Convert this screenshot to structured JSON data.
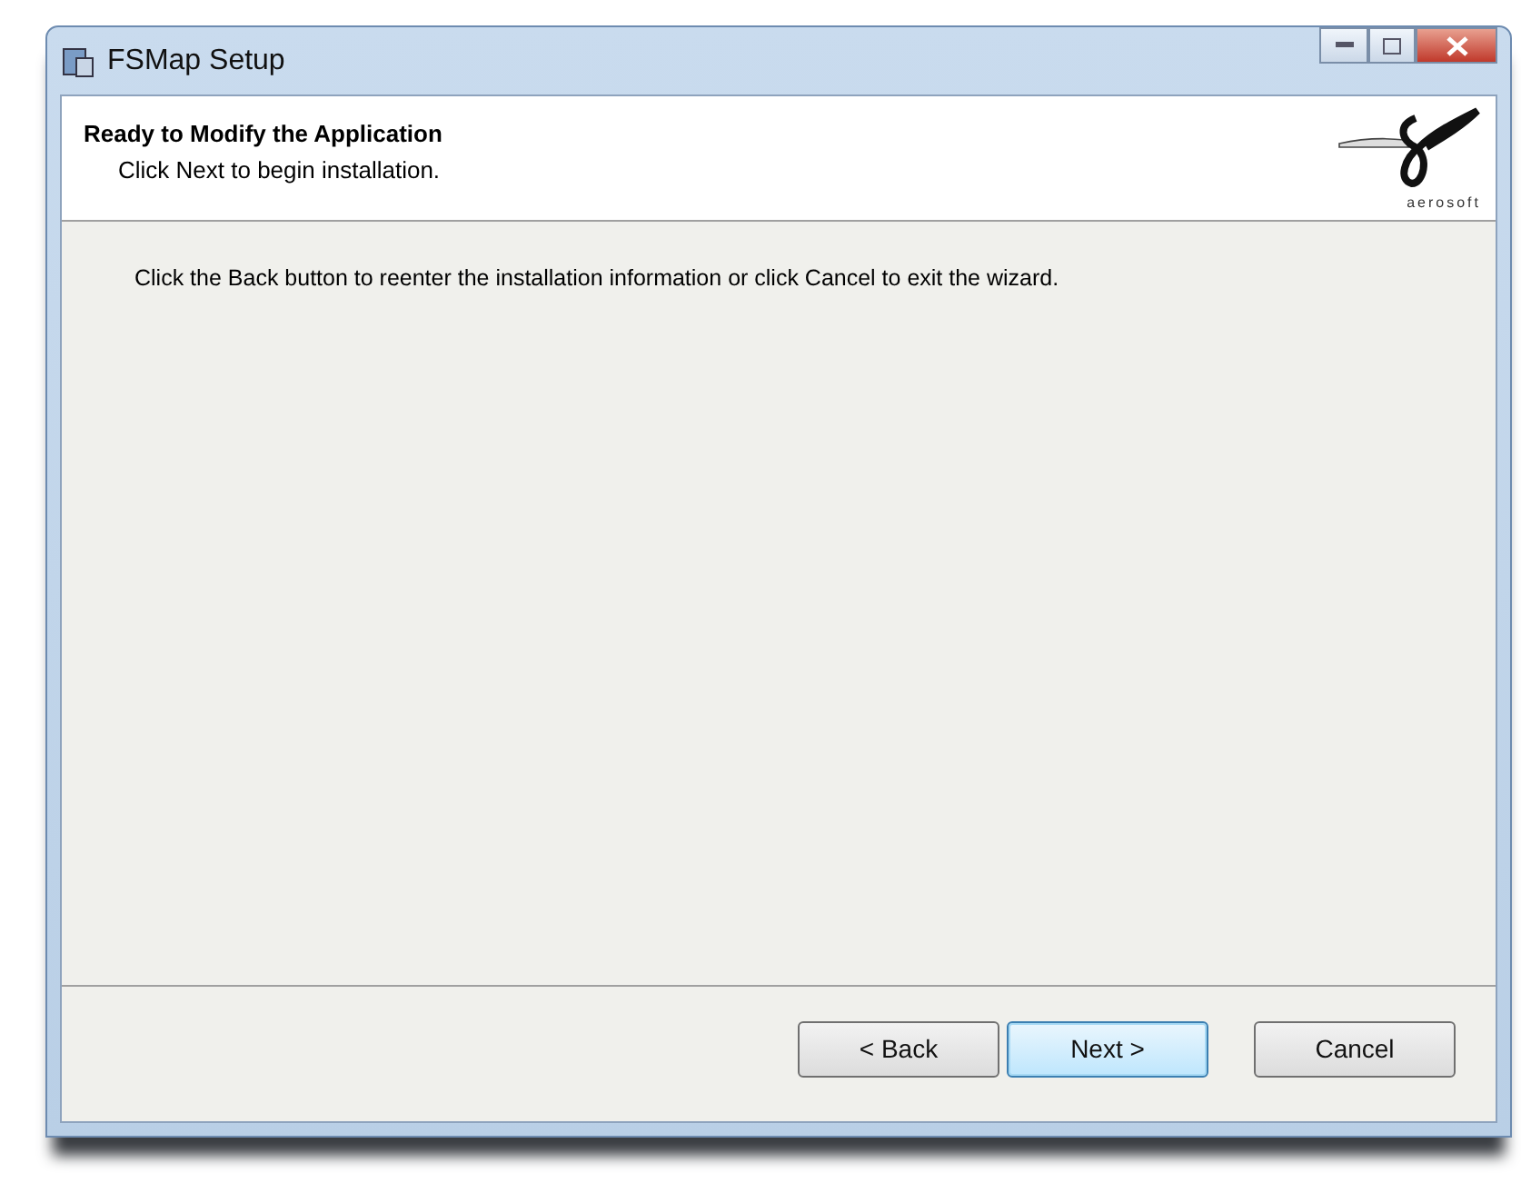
{
  "window": {
    "title": "FSMap Setup"
  },
  "header": {
    "title": "Ready to Modify the Application",
    "subtitle": "Click Next to begin installation.",
    "logo_text": "aerosoft"
  },
  "body": {
    "text": "Click the Back button to reenter the installation information or click Cancel to exit the wizard."
  },
  "buttons": [
    {
      "label": "< Back",
      "default": false
    },
    {
      "label": "Next >",
      "default": true
    },
    {
      "label": "Cancel",
      "default": false
    }
  ]
}
